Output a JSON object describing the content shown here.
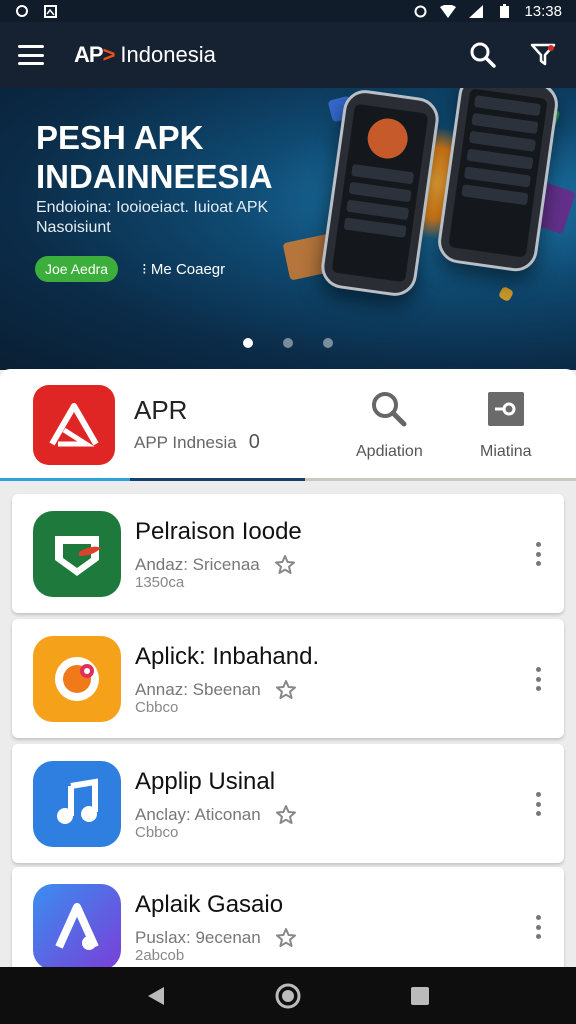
{
  "status_bar": {
    "time": "13:38"
  },
  "app_bar": {
    "logo": "AP",
    "title": "Indonesia"
  },
  "hero": {
    "title_line1": "PESH APK",
    "title_line2": "INDAINNEESIA",
    "subtitle": "Endoioina: Iooioeiact. Iuioat APK Nasoisiunt",
    "cta_label": "Joe Aedra",
    "link_label": "⁝ Me Coaegr",
    "slides": 3,
    "active_slide": 1
  },
  "featured": {
    "title": "APR",
    "subtitle": "APP Indnesia",
    "count": "0",
    "actions": [
      {
        "label": "Apdiation",
        "icon": "search-icon"
      },
      {
        "label": "Miatina",
        "icon": "key-icon"
      }
    ]
  },
  "apps": [
    {
      "name": "Pelraison Ioode",
      "meta": "Andaz: Sricenaa",
      "sub": "1350ca",
      "color": "#1d7a3c",
      "icon": "shield-app-icon"
    },
    {
      "name": "Aplick: Inbahand.",
      "meta": "Annaz: Sbeenan",
      "sub": "Cbbco",
      "color": "#f5a11a",
      "icon": "chat-app-icon"
    },
    {
      "name": "Applip Usinal",
      "meta": "Anclay: Aticonan",
      "sub": "Cbbco",
      "color": "#2f7fe0",
      "icon": "music-app-icon"
    },
    {
      "name": "Aplaik Gasaio",
      "meta": "Puslax: 9ecenan",
      "sub": "2abcob",
      "color": "#5b5ee0",
      "icon": "a-app-icon"
    }
  ],
  "colors": {
    "app_bar": "#162231",
    "accent_green": "#3cae3c",
    "featured_red": "#e02525"
  }
}
